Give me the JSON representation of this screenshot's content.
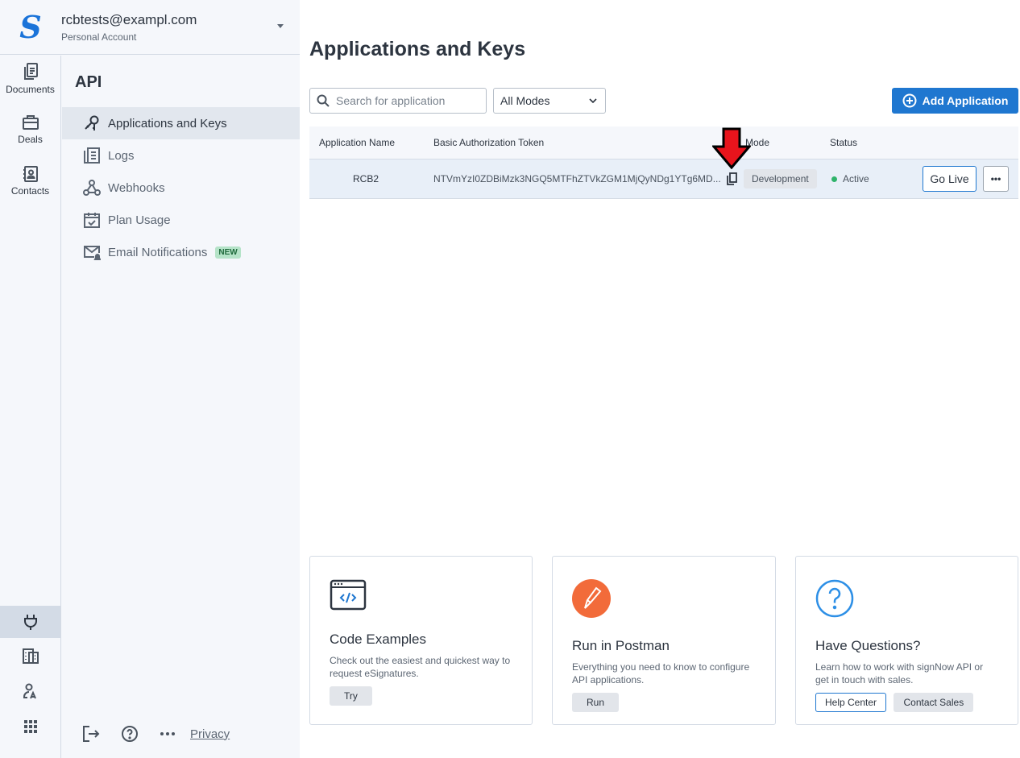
{
  "header": {
    "logo": "S",
    "email": "rcbtests@exampl.com",
    "account_type": "Personal Account"
  },
  "rail": {
    "items": [
      {
        "label": "Documents",
        "icon": "documents-icon"
      },
      {
        "label": "Deals",
        "icon": "briefcase-icon"
      },
      {
        "label": "Contacts",
        "icon": "contacts-icon"
      }
    ],
    "bottom": [
      {
        "icon": "plug-icon",
        "active": true
      },
      {
        "icon": "building-icon"
      },
      {
        "icon": "user-language-icon"
      },
      {
        "icon": "apps-grid-icon"
      }
    ]
  },
  "sidenav": {
    "title": "API",
    "items": [
      {
        "label": "Applications and Keys",
        "icon": "key-search-icon",
        "active": true
      },
      {
        "label": "Logs",
        "icon": "logs-icon"
      },
      {
        "label": "Webhooks",
        "icon": "webhook-icon"
      },
      {
        "label": "Plan Usage",
        "icon": "calendar-check-icon"
      },
      {
        "label": "Email Notifications",
        "icon": "mail-bell-icon",
        "badge": "NEW"
      }
    ]
  },
  "footer": {
    "privacy": "Privacy"
  },
  "main": {
    "title": "Applications and Keys",
    "search_placeholder": "Search for application",
    "mode_filter": "All Modes",
    "add_button": "Add Application",
    "columns": [
      "Application Name",
      "Basic Authorization Token",
      "Mode",
      "Status"
    ],
    "rows": [
      {
        "name": "RCB2",
        "token": "NTVmYzI0ZDBiMzk3NGQ5MTFhZTVkZGM1MjQyNDg1YTg6MD...",
        "mode": "Development",
        "status": "Active",
        "go_live": "Go Live",
        "more": "•••"
      }
    ],
    "cards": [
      {
        "title": "Code Examples",
        "text": "Check out the easiest and quickest way to request eSignatures.",
        "buttons": [
          "Try"
        ]
      },
      {
        "title": "Run in Postman",
        "text": "Everything you need to know to configure API applications.",
        "buttons": [
          "Run"
        ]
      },
      {
        "title": "Have Questions?",
        "text": "Learn how to work with signNow API or get in touch with sales.",
        "buttons": [
          "Help Center",
          "Contact Sales"
        ]
      }
    ]
  },
  "colors": {
    "accent": "#1f77d0",
    "active_status": "#2fb36b",
    "postman": "#f26b3a",
    "annotation_arrow": "#e8141c"
  }
}
